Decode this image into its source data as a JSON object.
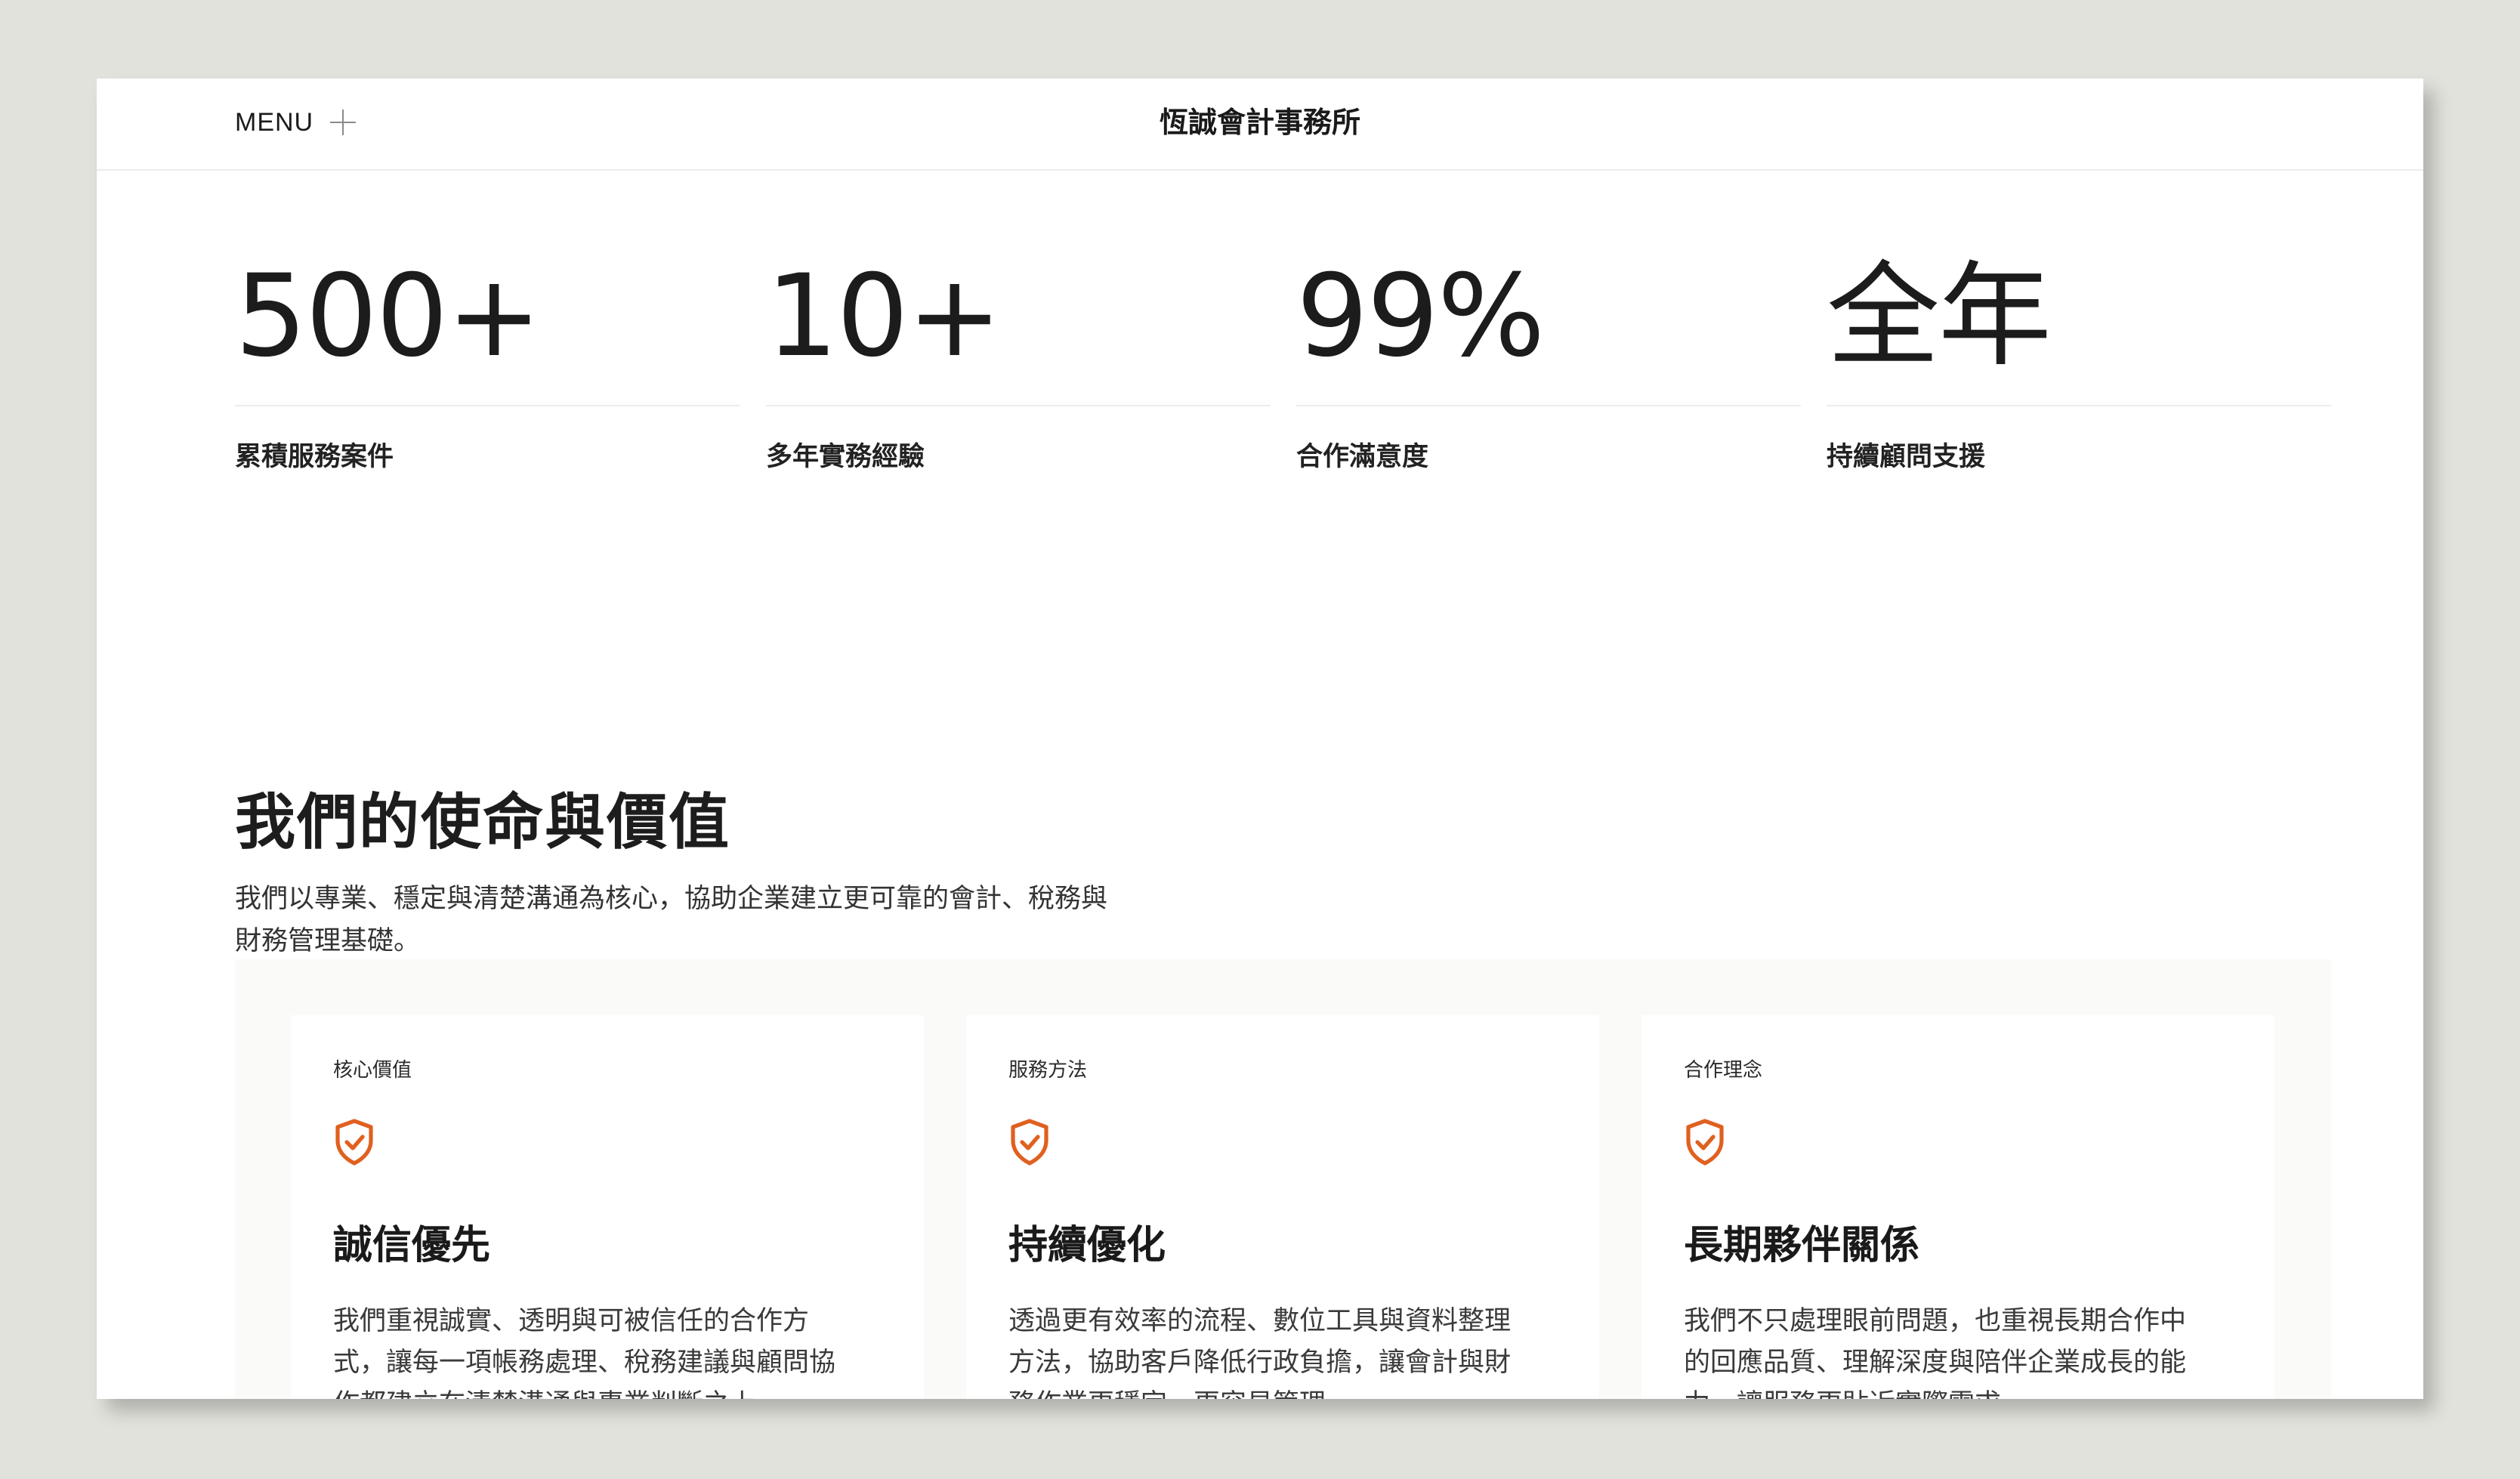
{
  "header": {
    "menu_label": "MENU",
    "menu_icon": "plus-icon",
    "site_title": "恆誠會計事務所"
  },
  "stats": [
    {
      "value": "500+",
      "label": "累積服務案件"
    },
    {
      "value": "10+",
      "label": "多年實務經驗"
    },
    {
      "value": "99%",
      "label": "合作滿意度"
    },
    {
      "value": "全年",
      "label": "持續顧問支援"
    }
  ],
  "mission": {
    "title": "我們的使命與價值",
    "description": "我們以專業、穩定與清楚溝通為核心，協助企業建立更可靠的會計、稅務與財務管理基礎。"
  },
  "cards": [
    {
      "tag": "核心價值",
      "icon": "shield-check-icon",
      "title": "誠信優先",
      "description": "我們重視誠實、透明與可被信任的合作方式，讓每一項帳務處理、稅務建議與顧問協作都建立在清楚溝通與專業判斷之上。"
    },
    {
      "tag": "服務方法",
      "icon": "shield-check-icon",
      "title": "持續優化",
      "description": "透過更有效率的流程、數位工具與資料整理方法，協助客戶降低行政負擔，讓會計與財務作業更穩定、更容易管理。"
    },
    {
      "tag": "合作理念",
      "icon": "shield-check-icon",
      "title": "長期夥伴關係",
      "description": "我們不只處理眼前問題，也重視長期合作中的回應品質、理解深度與陪伴企業成長的能力，讓服務更貼近實際需求。"
    }
  ],
  "colors": {
    "accent": "#e0601f",
    "page_bg": "#e2e2dc",
    "panel_bg": "#fafaf8"
  }
}
